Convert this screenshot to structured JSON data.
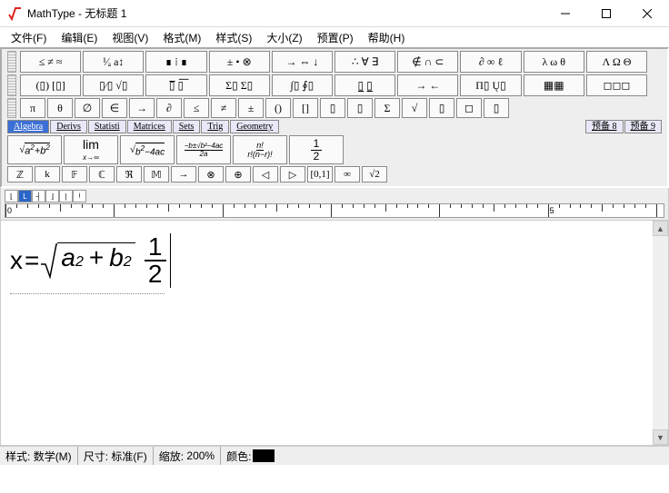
{
  "window": {
    "title": "MathType - 无标题 1"
  },
  "menu": {
    "file": "文件(F)",
    "edit": "编辑(E)",
    "view": "视图(V)",
    "format": "格式(M)",
    "style": "样式(S)",
    "size": "大小(Z)",
    "preset": "预置(P)",
    "help": "帮助(H)"
  },
  "palette": {
    "row1": [
      "≤ ≠ ≈",
      "¹∕ₐ a↕",
      "∎ ⁞ ∎",
      "± • ⊗",
      "→ ⇔ ↓",
      "∴ ∀ ∃",
      "∉ ∩ ⊂",
      "∂ ∞ ℓ",
      "λ ω θ",
      "Λ Ω Θ"
    ],
    "row2": [
      "(▯) [▯]",
      "▯⁄▯ √▯",
      "▯̅  ▯͞",
      "Σ▯ Σ▯",
      "∫▯ ∮▯",
      "▯̲  ▯̲",
      "→ ←",
      "Π▯ Ų▯",
      "▦▦",
      "◻◻◻"
    ],
    "row3": [
      "π",
      "θ",
      "∅",
      "∈",
      "→",
      "∂",
      "≤",
      "≠",
      "±",
      "()",
      "[]",
      "▯",
      "▯",
      "Σ",
      "√",
      "▯",
      "◻",
      "▯"
    ],
    "tabs": [
      "Algebra",
      "Derivs",
      "Statisti",
      "Matrices",
      "Sets",
      "Trig",
      "Geometry",
      "预备 8",
      "预备 9"
    ],
    "bigrow": [
      "√(a²+b²)",
      "lim x→∞",
      "√(b²−4ac)",
      "(−b±√(b²−4ac))/2a",
      "n! / r!(n−r)!",
      "1/2"
    ],
    "smallrow": [
      "ℤ",
      "k",
      "𝔽",
      "ℂ",
      "ℜ",
      "𝕄",
      "→",
      "⊗",
      "⊕",
      "◁",
      "▷",
      "[0,1]",
      "∞",
      "√2"
    ]
  },
  "ruler": {
    "marks": [
      "0",
      "5"
    ]
  },
  "formula": {
    "lhs": "x",
    "eq": "=",
    "a": "a",
    "b": "b",
    "sq": "2",
    "plus": "+",
    "num": "1",
    "den": "2"
  },
  "status": {
    "style_l": "样式:",
    "style_v": "数学(M)",
    "size_l": "尺寸:",
    "size_v": "标准(F)",
    "zoom_l": "缩放:",
    "zoom_v": "200%",
    "color_l": "颜色:"
  }
}
